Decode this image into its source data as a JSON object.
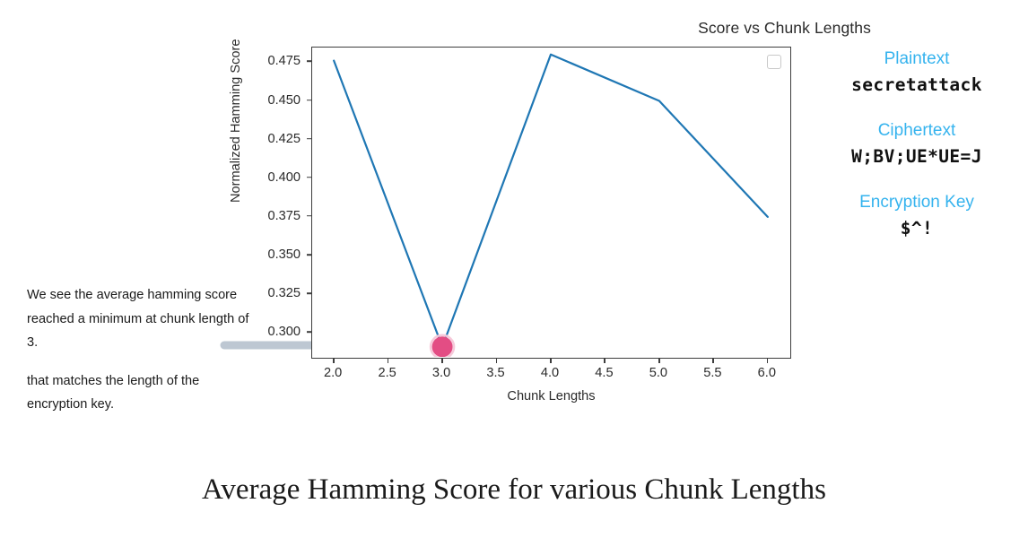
{
  "annotation": {
    "paragraph1": "We see the average hamming score reached a minimum at chunk length of 3.",
    "paragraph2": "that matches the length of the encryption key.",
    "arrow_name": "gray-arrow-to-minimum"
  },
  "info_panel": {
    "blocks": [
      {
        "heading": "Plaintext",
        "value": "secretattack"
      },
      {
        "heading": "Ciphertext",
        "value": "W;BV;UE*UE=J"
      },
      {
        "heading": "Encryption Key",
        "value": "$^!"
      }
    ],
    "heading_color": "#35b3ee",
    "value_color": "#111111"
  },
  "caption": {
    "text": "Average Hamming Score for various Chunk Lengths"
  },
  "chart_data": {
    "type": "line",
    "title": "Score vs Chunk Lengths",
    "xlabel": "Chunk Lengths",
    "ylabel": "Normalized Hamming Score",
    "x": [
      2,
      3,
      4,
      5,
      6
    ],
    "values": [
      0.476,
      0.291,
      0.48,
      0.45,
      0.375
    ],
    "series": [
      {
        "name": "Average Hamming Score",
        "values": [
          0.476,
          0.291,
          0.48,
          0.45,
          0.375
        ],
        "color": "#1f77b4"
      }
    ],
    "xlim": [
      1.8,
      6.2
    ],
    "ylim": [
      0.2845,
      0.4845
    ],
    "xticks": [
      "2.0",
      "2.5",
      "3.0",
      "3.5",
      "4.0",
      "4.5",
      "5.0",
      "5.5",
      "6.0"
    ],
    "xtick_values": [
      2.0,
      2.5,
      3.0,
      3.5,
      4.0,
      4.5,
      5.0,
      5.5,
      6.0
    ],
    "yticks": [
      "0.300",
      "0.325",
      "0.350",
      "0.375",
      "0.400",
      "0.425",
      "0.450",
      "0.475"
    ],
    "ytick_values": [
      0.3,
      0.325,
      0.35,
      0.375,
      0.4,
      0.425,
      0.45,
      0.475
    ],
    "grid": false,
    "legend": {
      "position": "upper right",
      "entries": []
    },
    "highlight": {
      "label": "minimum",
      "x": 3.0,
      "y": 0.291,
      "fill": "#e34d84",
      "ring": "#f6c9da"
    },
    "line_color": "#1f77b4",
    "line_width": 2.2
  }
}
